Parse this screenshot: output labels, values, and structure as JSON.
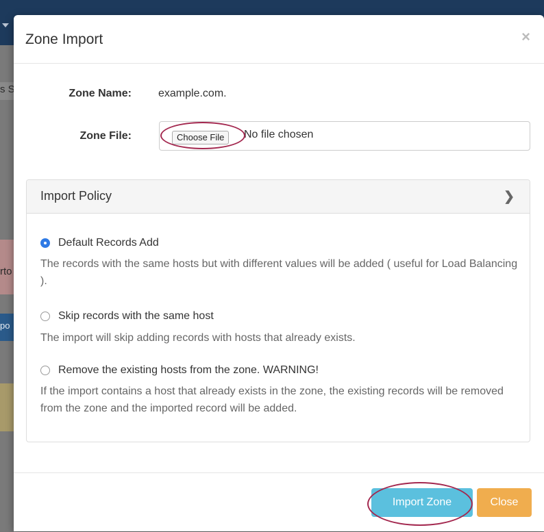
{
  "background": {
    "fragments": [
      "s S",
      "rto",
      "po"
    ]
  },
  "modal": {
    "title": "Zone Import",
    "close_symbol": "×"
  },
  "form": {
    "zone_name_label": "Zone Name:",
    "zone_name_value": "example.com.",
    "zone_file_label": "Zone File:",
    "choose_file_label": "Choose File",
    "file_status": "No file chosen"
  },
  "policy": {
    "title": "Import Policy",
    "chevron_icon": "chevron-right-icon",
    "options": [
      {
        "label": "Default Records Add",
        "checked": true,
        "description": "The records with the same hosts but with different values will be added ( useful for Load Balancing )."
      },
      {
        "label": "Skip records with the same host",
        "checked": false,
        "description": "The import will skip adding records with hosts that already exists."
      },
      {
        "label": "Remove the existing hosts from the zone. WARNING!",
        "checked": false,
        "description": "If the import contains a host that already exists in the zone, the existing records will be removed from the zone and the imported record will be added."
      }
    ]
  },
  "footer": {
    "import_label": "Import Zone",
    "close_label": "Close"
  },
  "colors": {
    "primary_radio": "#2f7ae5",
    "import_button": "#5bc0de",
    "close_button": "#f0ad4e",
    "highlight_circle": "#a3284f"
  }
}
